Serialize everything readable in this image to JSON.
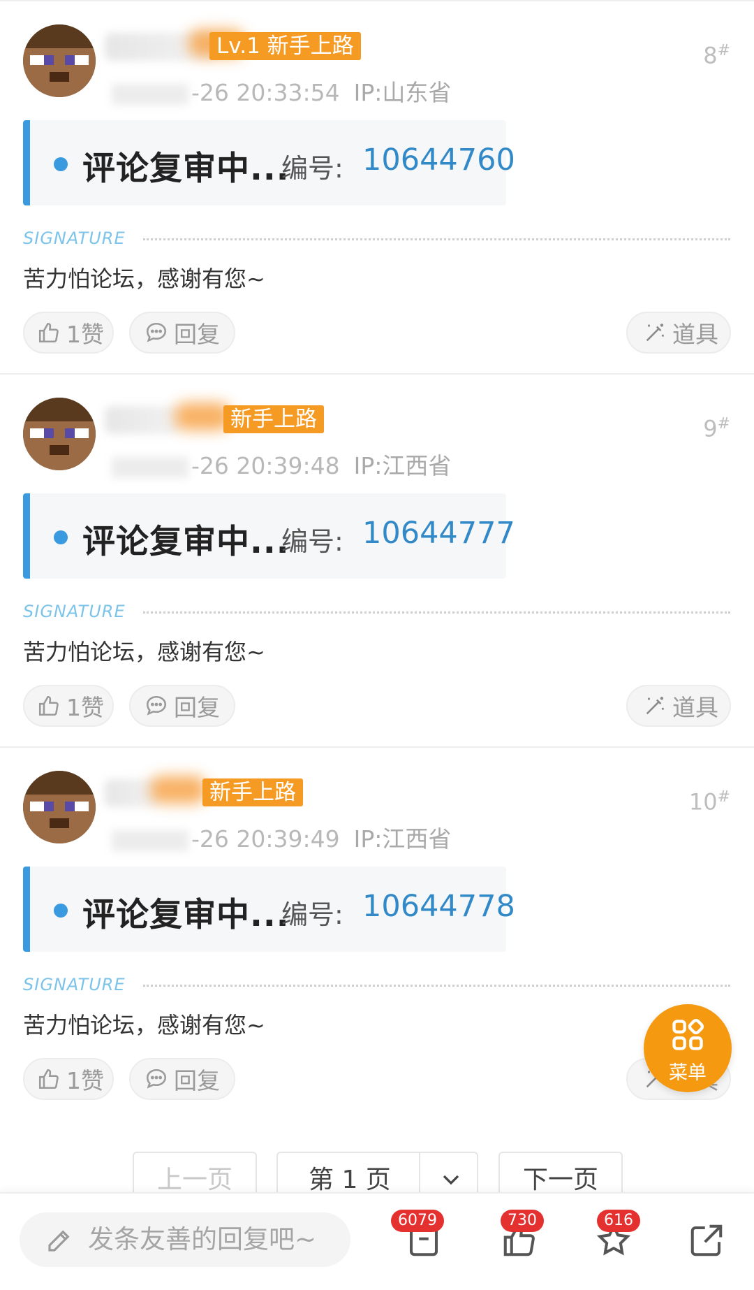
{
  "posts": [
    {
      "badge": "Lv.1 新手上路",
      "floor": "8",
      "floor_suffix": "#",
      "time": "-26 20:33:54",
      "ip": "IP:山东省",
      "review_status": "评论复审中...",
      "review_no_label": "编号:",
      "review_no": "10644760",
      "signature_label": "SIGNATURE",
      "signature": "苦力怕论坛，感谢有您~",
      "like_label": "1赞",
      "reply_label": "回复",
      "tool_label": "道具"
    },
    {
      "badge": "新手上路",
      "floor": "9",
      "floor_suffix": "#",
      "time": "-26 20:39:48",
      "ip": "IP:江西省",
      "review_status": "评论复审中...",
      "review_no_label": "编号:",
      "review_no": "10644777",
      "signature_label": "SIGNATURE",
      "signature": "苦力怕论坛，感谢有您~",
      "like_label": "1赞",
      "reply_label": "回复",
      "tool_label": "道具"
    },
    {
      "badge": "新手上路",
      "floor": "10",
      "floor_suffix": "#",
      "time": "-26 20:39:49",
      "ip": "IP:江西省",
      "review_status": "评论复审中...",
      "review_no_label": "编号:",
      "review_no": "10644778",
      "signature_label": "SIGNATURE",
      "signature": "苦力怕论坛，感谢有您~",
      "like_label": "1赞",
      "reply_label": "回复",
      "tool_label": "道具"
    }
  ],
  "fab": {
    "label": "菜单",
    "icon": "grid-icon"
  },
  "pager": {
    "prev_label": "上一页",
    "page_label": "第 1 页",
    "next_label": "下一页"
  },
  "bottombar": {
    "reply_placeholder": "发条友善的回复吧~",
    "comments_count": "6079",
    "likes_count": "730",
    "favorites_count": "616"
  },
  "colors": {
    "accent_blue": "#3a9ae0",
    "badge_orange": "#f59a23",
    "fab_orange": "#f59a10",
    "count_red": "#e53030"
  }
}
